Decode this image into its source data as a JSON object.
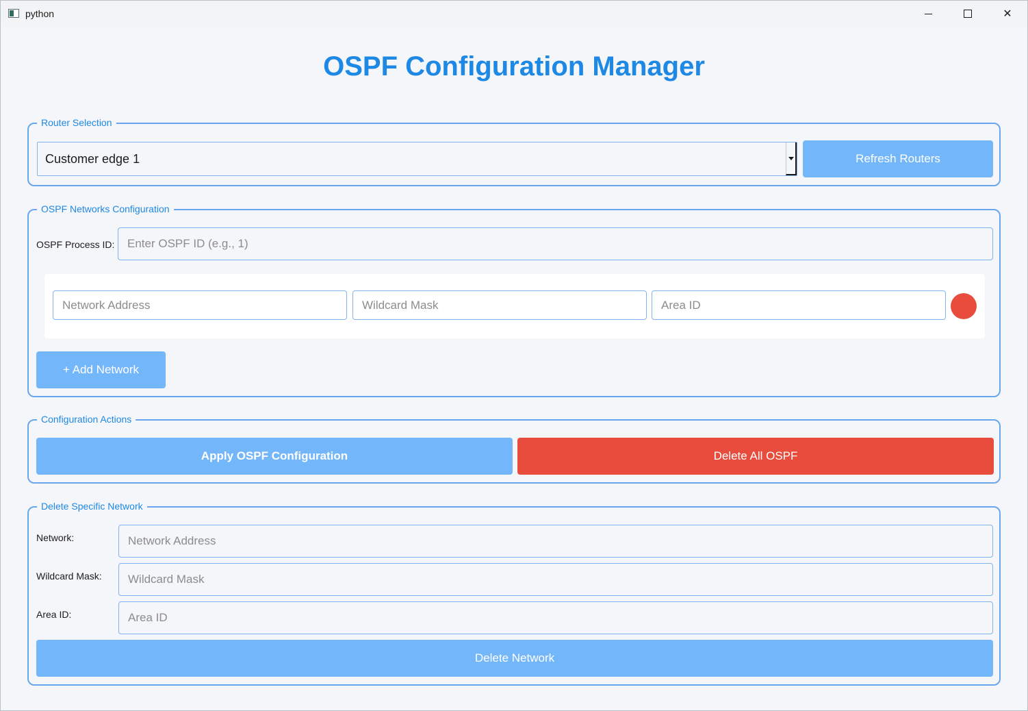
{
  "window": {
    "title": "python"
  },
  "app": {
    "title": "OSPF Configuration Manager"
  },
  "router_selection": {
    "group_label": "Router Selection",
    "selected_router": "Customer edge 1",
    "refresh_label": "Refresh Routers"
  },
  "ospf_networks": {
    "group_label": "OSPF Networks Configuration",
    "process_id_label": "OSPF Process ID:",
    "process_id_placeholder": "Enter OSPF ID (e.g., 1)",
    "row": {
      "network_placeholder": "Network Address",
      "wildcard_placeholder": "Wildcard Mask",
      "area_placeholder": "Area ID"
    },
    "add_network_label": "+ Add Network"
  },
  "config_actions": {
    "group_label": "Configuration Actions",
    "apply_label": "Apply OSPF Configuration",
    "delete_all_label": "Delete All OSPF"
  },
  "delete_specific": {
    "group_label": "Delete Specific Network",
    "network_label": "Network:",
    "network_placeholder": "Network Address",
    "wildcard_label": "Wildcard Mask:",
    "wildcard_placeholder": "Wildcard Mask",
    "area_label": "Area ID:",
    "area_placeholder": "Area ID",
    "delete_label": "Delete Network"
  },
  "colors": {
    "accent": "#1e88e5",
    "button_blue": "#74b6fa",
    "button_red": "#e74c3c",
    "group_border": "#6aa6ee"
  }
}
